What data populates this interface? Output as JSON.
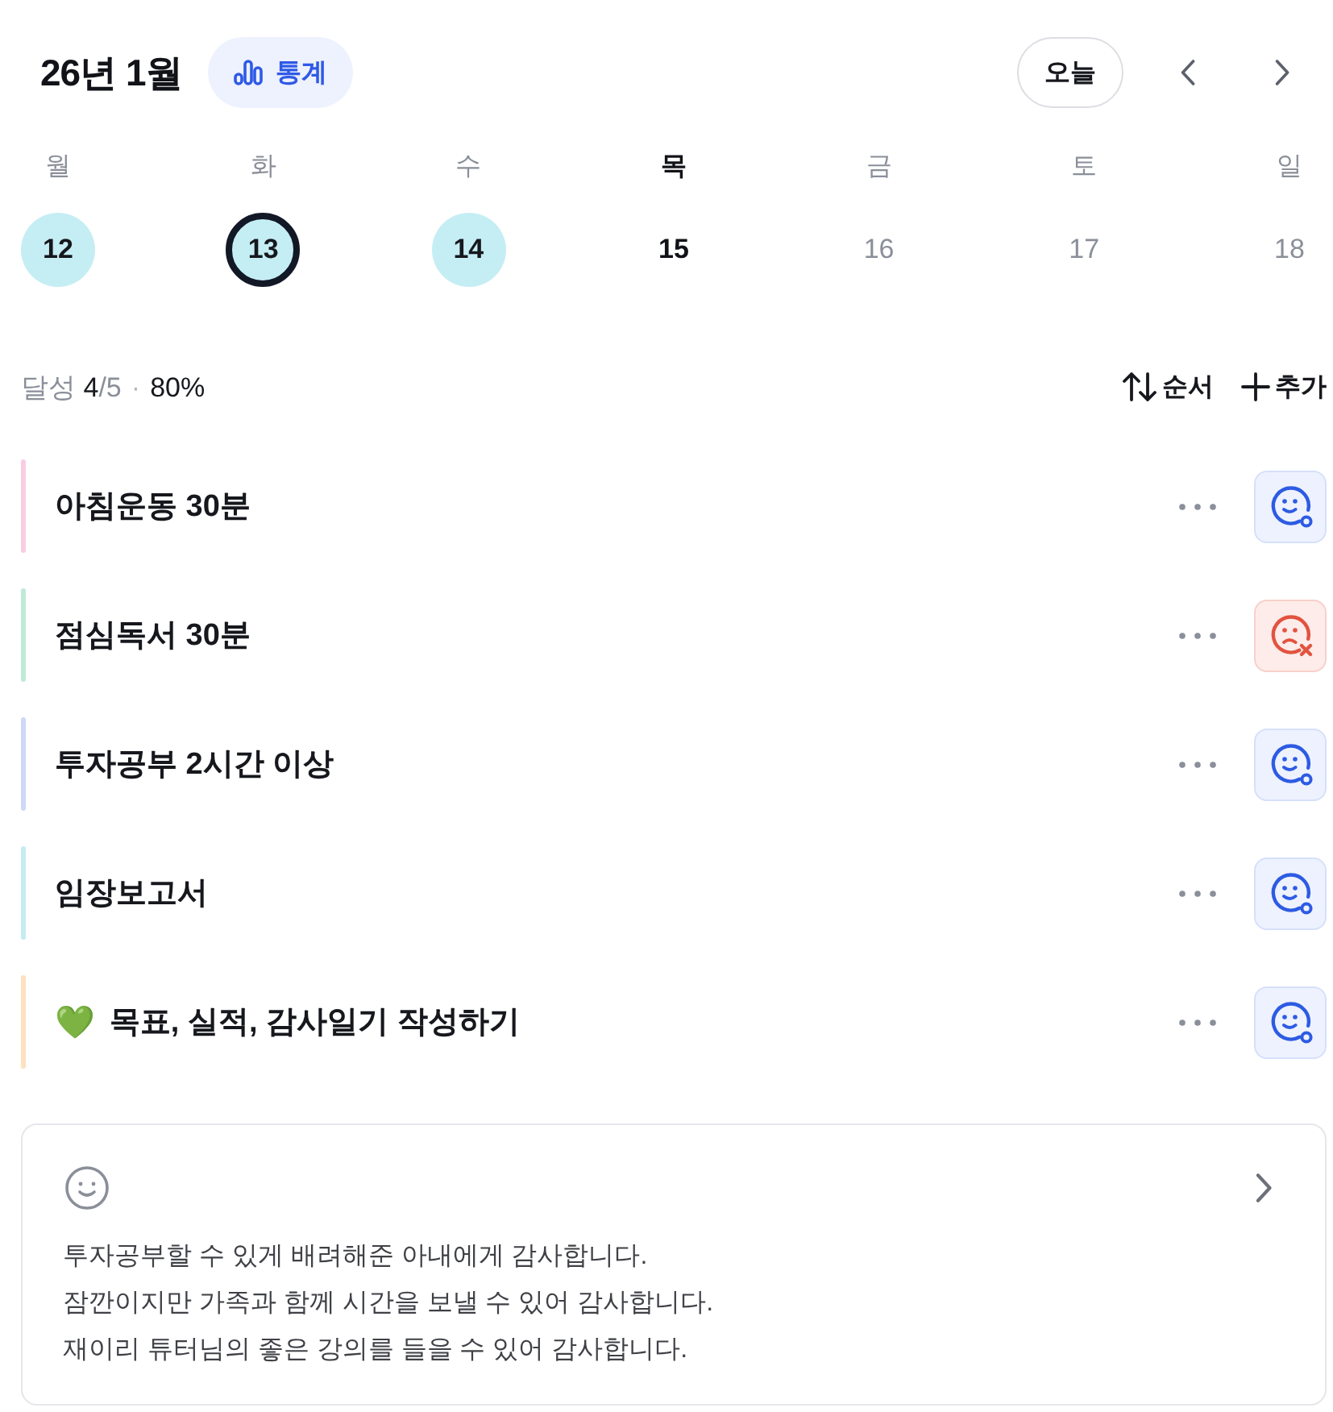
{
  "header": {
    "title": "26년 1월",
    "stats_button": "통계",
    "today_button": "오늘"
  },
  "days": [
    {
      "weekday": "월",
      "date": "12",
      "kind": "past",
      "achieved": true,
      "selected": false
    },
    {
      "weekday": "화",
      "date": "13",
      "kind": "past",
      "achieved": true,
      "selected": true
    },
    {
      "weekday": "수",
      "date": "14",
      "kind": "past",
      "achieved": true,
      "selected": false
    },
    {
      "weekday": "목",
      "date": "15",
      "kind": "today",
      "achieved": false,
      "selected": false
    },
    {
      "weekday": "금",
      "date": "16",
      "kind": "future",
      "achieved": false,
      "selected": false
    },
    {
      "weekday": "토",
      "date": "17",
      "kind": "future",
      "achieved": false,
      "selected": false
    },
    {
      "weekday": "일",
      "date": "18",
      "kind": "future",
      "achieved": false,
      "selected": false
    }
  ],
  "summary": {
    "label": "달성",
    "done": "4",
    "total": "/5",
    "separator": "·",
    "percent": "80%"
  },
  "actions": {
    "sort": "순서",
    "add": "추가"
  },
  "habits": [
    {
      "title": "아침운동 30분",
      "color": "#f8cde2",
      "done": true
    },
    {
      "title": "점심독서 30분",
      "color": "#bfead7",
      "done": false
    },
    {
      "title": "투자공부 2시간 이상",
      "color": "#cdd9f6",
      "done": true
    },
    {
      "title": "임장보고서",
      "color": "#c4ecf1",
      "done": true
    },
    {
      "emoji": "💚",
      "title": "목표, 실적, 감사일기 작성하기",
      "color": "#fde1c0",
      "done": true
    }
  ],
  "gratitude": {
    "lines": [
      "투자공부할 수 있게 배려해준 아내에게 감사합니다.",
      "잠깐이지만 가족과 함께 시간을 보낼 수 있어 감사합니다.",
      "재이리 튜터님의 좋은 강의를 들을 수 있어 감사합니다."
    ]
  }
}
